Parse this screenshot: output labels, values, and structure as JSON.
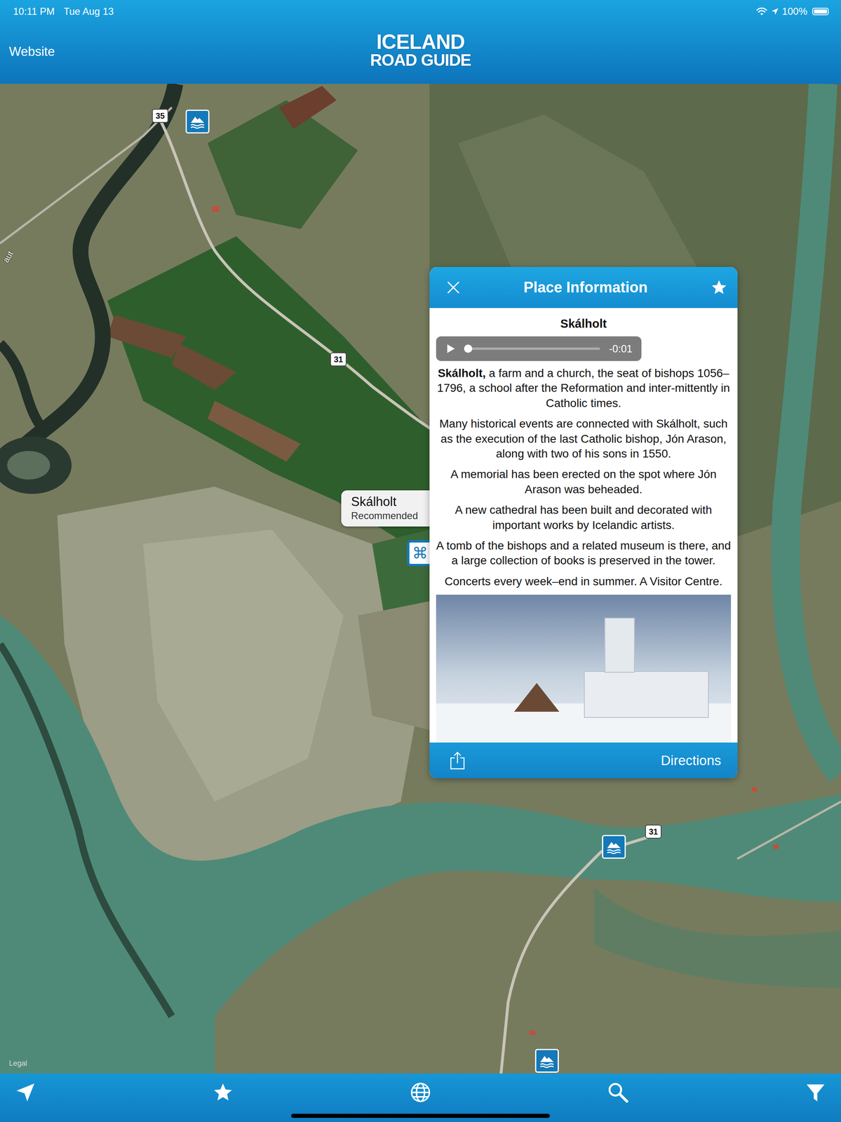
{
  "status_bar": {
    "time": "10:11 PM",
    "date": "Tue Aug 13",
    "battery": "100%",
    "battery_level": 1.0
  },
  "nav_bar": {
    "left_button": "Website",
    "logo_line1": "ICELAND",
    "logo_line2": "ROAD GUIDE"
  },
  "map": {
    "road_label": "aut",
    "legal": "Legal",
    "route_shields": [
      "35",
      "31",
      "31"
    ],
    "pins": [
      {
        "kind": "nature",
        "glyph": "",
        "selected": false
      },
      {
        "kind": "nature",
        "glyph": "",
        "selected": false
      },
      {
        "kind": "nature",
        "glyph": "",
        "selected": false
      },
      {
        "kind": "landmark",
        "glyph": "⌘",
        "selected": true
      }
    ],
    "callout": {
      "title": "Skálholt",
      "subtitle": "Recommended"
    }
  },
  "popup": {
    "title": "Place Information",
    "place": "Skálholt",
    "audio": {
      "time": "-0:01",
      "level": 0.0,
      "playing": false
    },
    "paragraphs": [
      {
        "lead": "Skálholt,",
        "text": " a farm and a church, the seat of bishops 1056–1796, a school after the Reformation and inter-mittently in Catholic times."
      },
      {
        "lead": "",
        "text": "Many historical events are connected with Skálholt, such as the execution of the last Catholic bishop, Jón Arason, along with two of his sons in 1550."
      },
      {
        "lead": "",
        "text": "A memorial has been erected on the spot where Jón Arason was beheaded."
      },
      {
        "lead": "",
        "text": "A new cathedral has been built and decorated with important works by Icelandic artists."
      },
      {
        "lead": "",
        "text": "A tomb of the bishops and a related museum is there, and a large collection of books is preserved in the tower."
      },
      {
        "lead": "",
        "text": "Concerts every week–end in summer. A Visitor Centre."
      }
    ],
    "directions": "Directions"
  }
}
